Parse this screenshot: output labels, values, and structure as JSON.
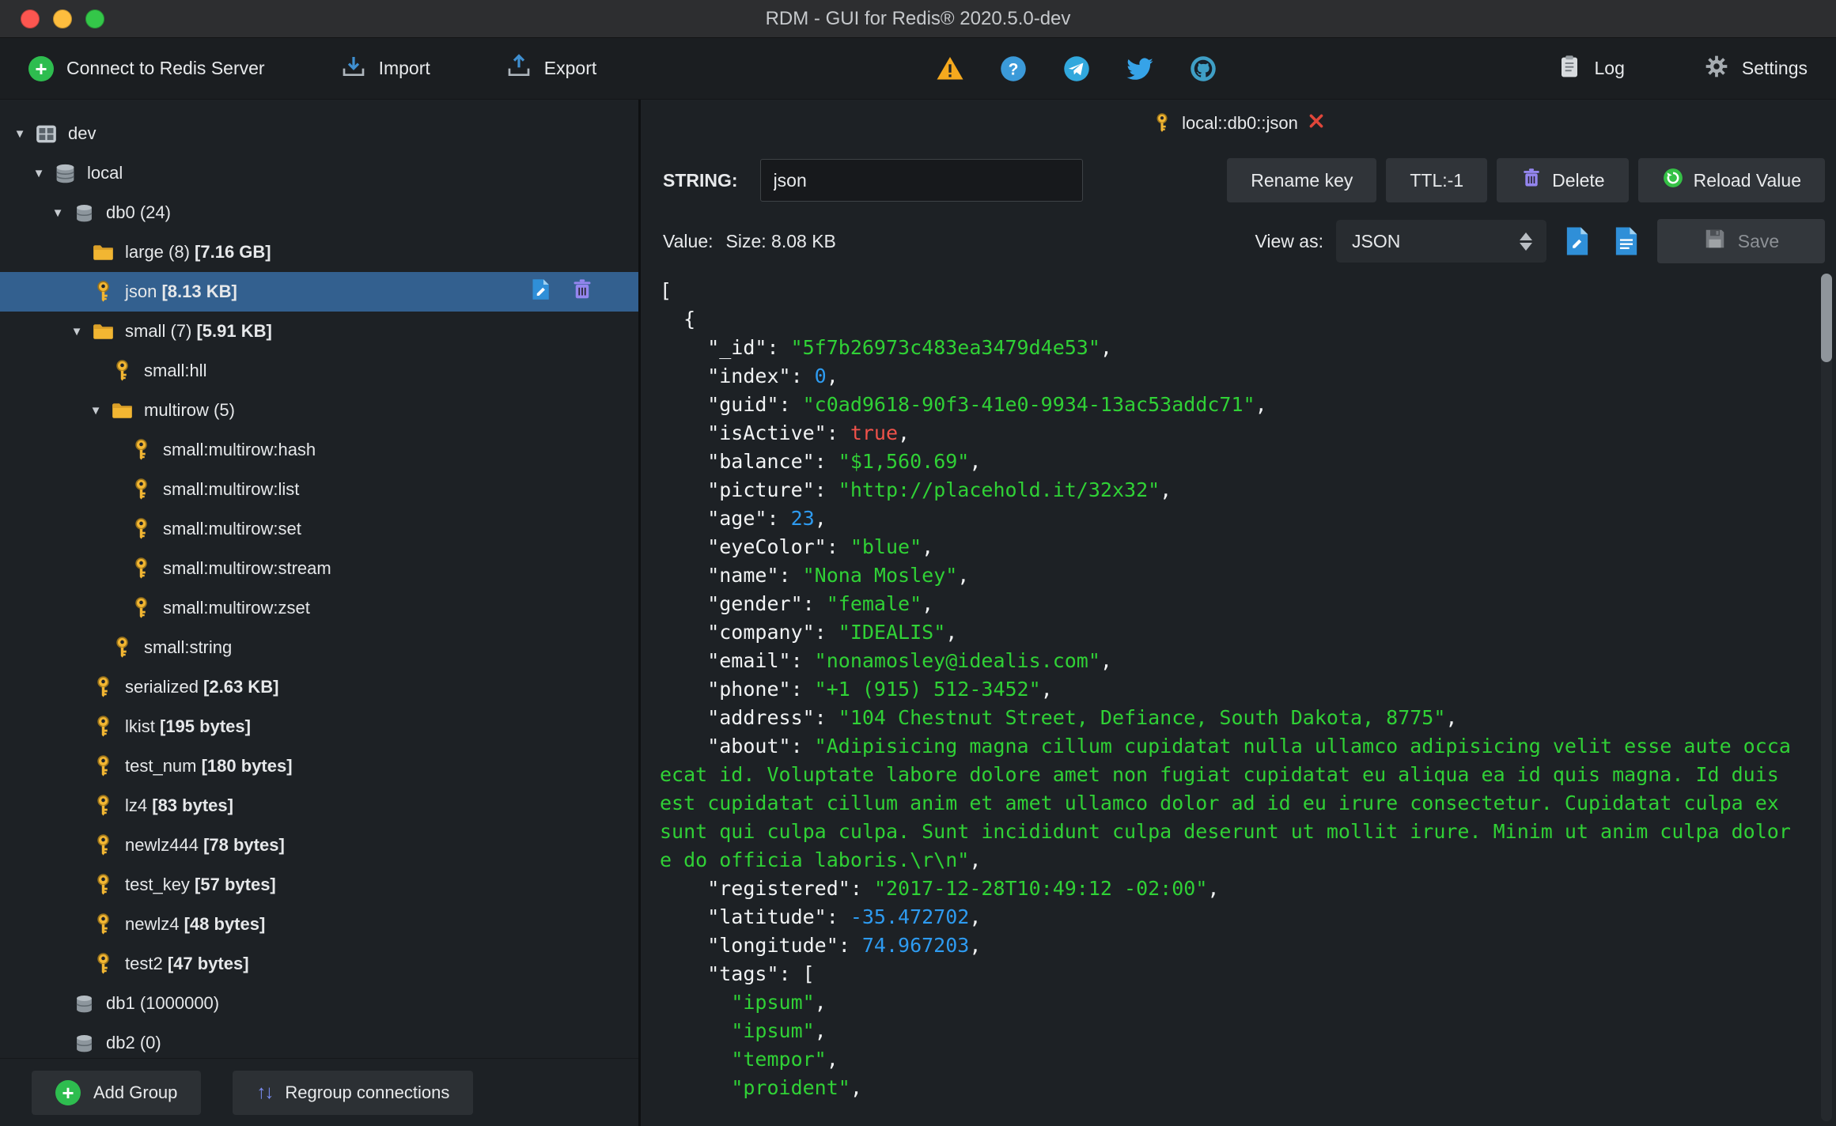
{
  "window": {
    "title": "RDM - GUI for Redis® 2020.5.0-dev"
  },
  "toolbar": {
    "connect_label": "Connect to Redis Server",
    "import_label": "Import",
    "export_label": "Export",
    "log_label": "Log",
    "settings_label": "Settings"
  },
  "sidebar": {
    "add_group_label": "Add Group",
    "regroup_label": "Regroup connections",
    "tree": [
      {
        "level": 0,
        "icon": "server",
        "arrow": true,
        "label": "dev"
      },
      {
        "level": 1,
        "icon": "dbstack",
        "arrow": true,
        "label": "local"
      },
      {
        "level": 2,
        "icon": "db",
        "arrow": true,
        "label": "db0",
        "count": "(24)"
      },
      {
        "level": 3,
        "icon": "folder",
        "arrow": false,
        "label": "large",
        "count": "(8)",
        "size": "[7.16 GB]"
      },
      {
        "level": 3,
        "icon": "key",
        "arrow": false,
        "label": "json",
        "size": "[8.13 KB]",
        "selected": true,
        "actions": true
      },
      {
        "level": 3,
        "icon": "folder",
        "arrow": true,
        "label": "small",
        "count": "(7)",
        "size": "[5.91 KB]"
      },
      {
        "level": 4,
        "icon": "key",
        "arrow": false,
        "label": "small:hll"
      },
      {
        "level": 4,
        "icon": "folder",
        "arrow": true,
        "label": "multirow",
        "count": "(5)"
      },
      {
        "level": 5,
        "icon": "key",
        "arrow": false,
        "label": "small:multirow:hash"
      },
      {
        "level": 5,
        "icon": "key",
        "arrow": false,
        "label": "small:multirow:list"
      },
      {
        "level": 5,
        "icon": "key",
        "arrow": false,
        "label": "small:multirow:set"
      },
      {
        "level": 5,
        "icon": "key",
        "arrow": false,
        "label": "small:multirow:stream"
      },
      {
        "level": 5,
        "icon": "key",
        "arrow": false,
        "label": "small:multirow:zset"
      },
      {
        "level": 4,
        "icon": "key",
        "arrow": false,
        "label": "small:string"
      },
      {
        "level": 3,
        "icon": "key",
        "arrow": false,
        "label": "serialized",
        "size": "[2.63 KB]"
      },
      {
        "level": 3,
        "icon": "key",
        "arrow": false,
        "label": "lkist",
        "size": "[195 bytes]"
      },
      {
        "level": 3,
        "icon": "key",
        "arrow": false,
        "label": "test_num",
        "size": "[180 bytes]"
      },
      {
        "level": 3,
        "icon": "key",
        "arrow": false,
        "label": "lz4",
        "size": "[83 bytes]"
      },
      {
        "level": 3,
        "icon": "key",
        "arrow": false,
        "label": "newlz444",
        "size": "[78 bytes]"
      },
      {
        "level": 3,
        "icon": "key",
        "arrow": false,
        "label": "test_key",
        "size": "[57 bytes]"
      },
      {
        "level": 3,
        "icon": "key",
        "arrow": false,
        "label": "newlz4",
        "size": "[48 bytes]"
      },
      {
        "level": 3,
        "icon": "key",
        "arrow": false,
        "label": "test2",
        "size": "[47 bytes]"
      },
      {
        "level": 2,
        "icon": "db",
        "arrow": false,
        "label": "db1",
        "count": "(1000000)"
      },
      {
        "level": 2,
        "icon": "db",
        "arrow": false,
        "label": "db2",
        "count": "(0)"
      }
    ]
  },
  "main": {
    "tab_label": "local::db0::json",
    "type_label": "STRING:",
    "key_value": "json",
    "rename_label": "Rename key",
    "ttl_label": "TTL:-1",
    "delete_label": "Delete",
    "reload_label": "Reload Value",
    "value_label": "Value:",
    "size_label": "Size: 8.08 KB",
    "view_as_label": "View as:",
    "view_mode": "JSON",
    "save_label": "Save",
    "editor": {
      "lines": [
        [
          [
            "p",
            "["
          ]
        ],
        [
          [
            "p",
            "  {"
          ]
        ],
        [
          [
            "p",
            "    \"_id\": "
          ],
          [
            "s",
            "\"5f7b26973c483ea3479d4e53\""
          ],
          [
            "p",
            ","
          ]
        ],
        [
          [
            "p",
            "    \"index\": "
          ],
          [
            "n",
            "0"
          ],
          [
            "p",
            ","
          ]
        ],
        [
          [
            "p",
            "    \"guid\": "
          ],
          [
            "s",
            "\"c0ad9618-90f3-41e0-9934-13ac53addc71\""
          ],
          [
            "p",
            ","
          ]
        ],
        [
          [
            "p",
            "    \"isActive\": "
          ],
          [
            "b",
            "true"
          ],
          [
            "p",
            ","
          ]
        ],
        [
          [
            "p",
            "    \"balance\": "
          ],
          [
            "s",
            "\"$1,560.69\""
          ],
          [
            "p",
            ","
          ]
        ],
        [
          [
            "p",
            "    \"picture\": "
          ],
          [
            "s",
            "\"http://placehold.it/32x32\""
          ],
          [
            "p",
            ","
          ]
        ],
        [
          [
            "p",
            "    \"age\": "
          ],
          [
            "n",
            "23"
          ],
          [
            "p",
            ","
          ]
        ],
        [
          [
            "p",
            "    \"eyeColor\": "
          ],
          [
            "s",
            "\"blue\""
          ],
          [
            "p",
            ","
          ]
        ],
        [
          [
            "p",
            "    \"name\": "
          ],
          [
            "s",
            "\"Nona Mosley\""
          ],
          [
            "p",
            ","
          ]
        ],
        [
          [
            "p",
            "    \"gender\": "
          ],
          [
            "s",
            "\"female\""
          ],
          [
            "p",
            ","
          ]
        ],
        [
          [
            "p",
            "    \"company\": "
          ],
          [
            "s",
            "\"IDEALIS\""
          ],
          [
            "p",
            ","
          ]
        ],
        [
          [
            "p",
            "    \"email\": "
          ],
          [
            "s",
            "\"nonamosley@idealis.com\""
          ],
          [
            "p",
            ","
          ]
        ],
        [
          [
            "p",
            "    \"phone\": "
          ],
          [
            "s",
            "\"+1 (915) 512-3452\""
          ],
          [
            "p",
            ","
          ]
        ],
        [
          [
            "p",
            "    \"address\": "
          ],
          [
            "s",
            "\"104 Chestnut Street, Defiance, South Dakota, 8775\""
          ],
          [
            "p",
            ","
          ]
        ],
        [
          [
            "p",
            "    \"about\": "
          ],
          [
            "s",
            "\"Adipisicing magna cillum cupidatat nulla ullamco adipisicing velit esse aute occa"
          ]
        ],
        [
          [
            "s",
            "ecat id. Voluptate labore dolore amet non fugiat cupidatat eu aliqua ea id quis magna. Id duis "
          ]
        ],
        [
          [
            "s",
            "est cupidatat cillum anim et amet ullamco dolor ad id eu irure consectetur. Cupidatat culpa ex "
          ]
        ],
        [
          [
            "s",
            "sunt qui culpa culpa. Sunt incididunt culpa deserunt ut mollit irure. Minim ut anim culpa dolor"
          ]
        ],
        [
          [
            "s",
            "e do officia laboris.\\r\\n\""
          ],
          [
            "p",
            ","
          ]
        ],
        [
          [
            "p",
            "    \"registered\": "
          ],
          [
            "s",
            "\"2017-12-28T10:49:12 -02:00\""
          ],
          [
            "p",
            ","
          ]
        ],
        [
          [
            "p",
            "    \"latitude\": "
          ],
          [
            "n",
            "-35.472702"
          ],
          [
            "p",
            ","
          ]
        ],
        [
          [
            "p",
            "    \"longitude\": "
          ],
          [
            "n",
            "74.967203"
          ],
          [
            "p",
            ","
          ]
        ],
        [
          [
            "p",
            "    \"tags\": ["
          ]
        ],
        [
          [
            "p",
            "      "
          ],
          [
            "s",
            "\"ipsum\""
          ],
          [
            "p",
            ","
          ]
        ],
        [
          [
            "p",
            "      "
          ],
          [
            "s",
            "\"ipsum\""
          ],
          [
            "p",
            ","
          ]
        ],
        [
          [
            "p",
            "      "
          ],
          [
            "s",
            "\"tempor\""
          ],
          [
            "p",
            ","
          ]
        ],
        [
          [
            "p",
            "      "
          ],
          [
            "s",
            "\"proident\""
          ],
          [
            "p",
            ","
          ]
        ]
      ]
    }
  }
}
